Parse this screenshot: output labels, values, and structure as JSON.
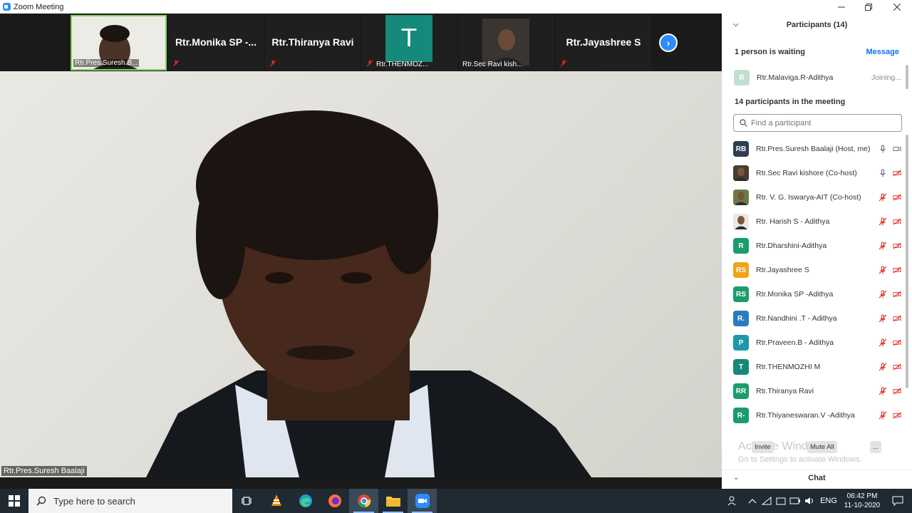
{
  "window": {
    "title": "Zoom Meeting"
  },
  "gallery": {
    "tiles": [
      {
        "caption": "Rtr.Pres.Suresh B..."
      },
      {
        "name": "Rtr.Monika  SP  -..."
      },
      {
        "name": "Rtr.Thiranya Ravi"
      },
      {
        "initial": "T",
        "caption": "Rtr.THENMOZ..."
      },
      {
        "caption": "Rtr.Sec Ravi kish..."
      },
      {
        "name": "Rtr.Jayashree S"
      }
    ]
  },
  "main": {
    "speaker_label": "Rtr.Pres.Suresh Baalaji"
  },
  "panel": {
    "title": "Participants (14)",
    "waiting_text": "1 person is waiting",
    "message_label": "Message",
    "waiting": {
      "initials": "R",
      "name": "Rtr.Malaviga.R-Adithya",
      "status": "Joining..."
    },
    "in_meeting_text": "14 participants in the meeting",
    "search_placeholder": "Find a participant",
    "participants": [
      {
        "initials": "RB",
        "color": "#2d3e50",
        "name": "Rtr.Pres.Suresh Baalaji (Host, me)",
        "mic": "on",
        "video": "on"
      },
      {
        "initials": "",
        "color": "#4a3b2e",
        "name": "Rtr.Sec Ravi kishore (Co-host)",
        "mic": "on",
        "video": "off"
      },
      {
        "initials": "",
        "color": "#6b7a4a",
        "name": "Rtr. V. G. Iswarya-AIT (Co-host)",
        "mic": "off",
        "video": "off"
      },
      {
        "initials": "",
        "color": "#e8e8e8",
        "name": "Rtr. Harish S - Adithya",
        "mic": "off",
        "video": "off"
      },
      {
        "initials": "R",
        "color": "#1a9c6c",
        "name": "Rtr.Dharshini-Adithya",
        "mic": "off",
        "video": "off"
      },
      {
        "initials": "RS",
        "color": "#f0a21b",
        "name": "Rtr.Jayashree S",
        "mic": "off",
        "video": "off"
      },
      {
        "initials": "RS",
        "color": "#1a9c6c",
        "name": "Rtr.Monika SP -Adithya",
        "mic": "off",
        "video": "off"
      },
      {
        "initials": "R.",
        "color": "#2b7ac0",
        "name": "Rtr.Nandhini .T - Adithya",
        "mic": "off",
        "video": "off"
      },
      {
        "initials": "P",
        "color": "#1e9aa6",
        "name": "Rtr.Praveen.B - Adithya",
        "mic": "off",
        "video": "off"
      },
      {
        "initials": "T",
        "color": "#15897a",
        "name": "Rtr.THENMOZHI M",
        "mic": "off",
        "video": "off"
      },
      {
        "initials": "RR",
        "color": "#1a9c6c",
        "name": "Rtr.Thiranya Ravi",
        "mic": "off",
        "video": "off"
      },
      {
        "initials": "R-",
        "color": "#1a9c6c",
        "name": "Rtr.Thiyaneswaran.V -Adithya",
        "mic": "off",
        "video": "off"
      }
    ],
    "footer": {
      "invite": "Invite",
      "mute_all": "Mute All",
      "more": "..."
    },
    "watermark": {
      "line1": "Activate Windows",
      "line2": "Go to Settings to activate Windows."
    },
    "chat_label": "Chat"
  },
  "taskbar": {
    "search_placeholder": "Type here to search",
    "lang": "ENG",
    "time": "06:42 PM",
    "date": "11-10-2020"
  },
  "colors": {
    "accent": "#2d8cff",
    "mute_red": "#e02828",
    "active_border": "#7dd35a"
  }
}
